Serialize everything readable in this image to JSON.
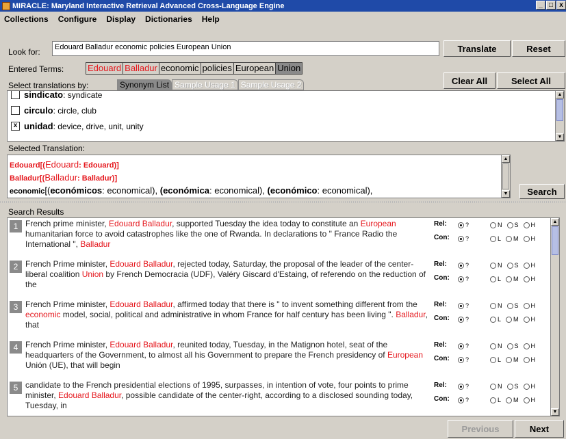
{
  "window": {
    "title": "MIRACLE: Maryland Interactive Retrieval Advanced Cross-Language Engine",
    "controls": {
      "minimize": "_",
      "maximize": "□",
      "close": "x"
    }
  },
  "menu": [
    "Collections",
    "Configure",
    "Display",
    "Dictionaries",
    "Help"
  ],
  "lookfor": {
    "label": "Look for:",
    "value": "Edouard Balladur economic policies European Union",
    "translate_label": "Translate",
    "reset_label": "Reset"
  },
  "entered_terms": {
    "label": "Entered Terms:",
    "terms": [
      "Edouard",
      "Balladur",
      "economic",
      "policies",
      "European",
      "Union"
    ]
  },
  "select_by": {
    "label": "Select translations by:",
    "tabs": [
      "Synonym List",
      "Sample Usage 1",
      "Sample Usage 2"
    ],
    "clear_all_label": "Clear All",
    "select_all_label": "Select All"
  },
  "synonyms": [
    {
      "word": "sindicato",
      "gloss": " : syndicate",
      "checked": false
    },
    {
      "word": "circulo",
      "gloss": " : circle, club",
      "checked": false
    },
    {
      "word": "unidad",
      "gloss": " : device, drive, unit, unity",
      "checked": true
    }
  ],
  "selected_translation": {
    "label": "Selected Translation:",
    "line1": {
      "a": "Edouard[(",
      "b": "Edouard",
      "c": ": Edouard)]"
    },
    "line2": {
      "a": "Balladur[(",
      "b": "Balladur",
      "c": ": Balladur)]"
    },
    "line3": {
      "head": "economic",
      "p1": "[(",
      "w1": "económicos",
      "g1": ": economical), ",
      "p2": "(",
      "w2": "económica",
      "g2": ": economical), ",
      "p3": "(",
      "w3": "económico",
      "g3": ": economical),"
    },
    "search_label": "Search"
  },
  "results": {
    "label": "Search Results",
    "rel_label": "Rel:",
    "con_label": "Con:",
    "q_label": "?",
    "rel_options": [
      "N",
      "S",
      "H"
    ],
    "con_options": [
      "L",
      "M",
      "H"
    ],
    "items": [
      {
        "num": "1",
        "segments": [
          {
            "t": "French prime minister, ",
            "r": false
          },
          {
            "t": "Edouard Balladur",
            "r": true
          },
          {
            "t": ", supported Tuesday the idea today to constitute an ",
            "r": false
          },
          {
            "t": "European",
            "r": true
          },
          {
            "t": " humanitarian force to avoid catastrophes like the one of Rwanda. In declarations to \" France Radio the International \", ",
            "r": false
          },
          {
            "t": "Balladur",
            "r": true
          }
        ]
      },
      {
        "num": "2",
        "segments": [
          {
            "t": "French Prime minister, ",
            "r": false
          },
          {
            "t": "Edouard Balladur",
            "r": true
          },
          {
            "t": ", rejected today, Saturday, the proposal of the leader of the center-liberal coalition ",
            "r": false
          },
          {
            "t": "Union",
            "r": true
          },
          {
            "t": " by French Democracia (UDF), Valéry Giscard d'Estaing, of referendo on the reduction of the",
            "r": false
          }
        ]
      },
      {
        "num": "3",
        "segments": [
          {
            "t": "French Prime minister, ",
            "r": false
          },
          {
            "t": "Edouard Balladur",
            "r": true
          },
          {
            "t": ", affirmed today that there is \" to invent something different from the ",
            "r": false
          },
          {
            "t": "economic",
            "r": true
          },
          {
            "t": " model, social, political and administrative in whom France for half century has been living \". ",
            "r": false
          },
          {
            "t": "Balladur",
            "r": true
          },
          {
            "t": ", that",
            "r": false
          }
        ]
      },
      {
        "num": "4",
        "segments": [
          {
            "t": "French Prime minister, ",
            "r": false
          },
          {
            "t": "Edouard Balladur",
            "r": true
          },
          {
            "t": ", reunited today, Tuesday, in the Matignon hotel, seat of the headquarters of the Government, to almost all his Government to prepare the French presidency of ",
            "r": false
          },
          {
            "t": "European",
            "r": true
          },
          {
            "t": " Unión (UE), that will begin",
            "r": false
          }
        ]
      },
      {
        "num": "5",
        "segments": [
          {
            "t": "candidate to the French presidential elections of 1995, surpasses, in intention of vote, four points to prime minister, ",
            "r": false
          },
          {
            "t": "Edouard Balladur",
            "r": true
          },
          {
            "t": ", possible candidate of the center-right, according to a disclosed sounding today, Tuesday, in",
            "r": false
          }
        ]
      }
    ]
  },
  "nav": {
    "previous_label": "Previous",
    "next_label": "Next"
  }
}
